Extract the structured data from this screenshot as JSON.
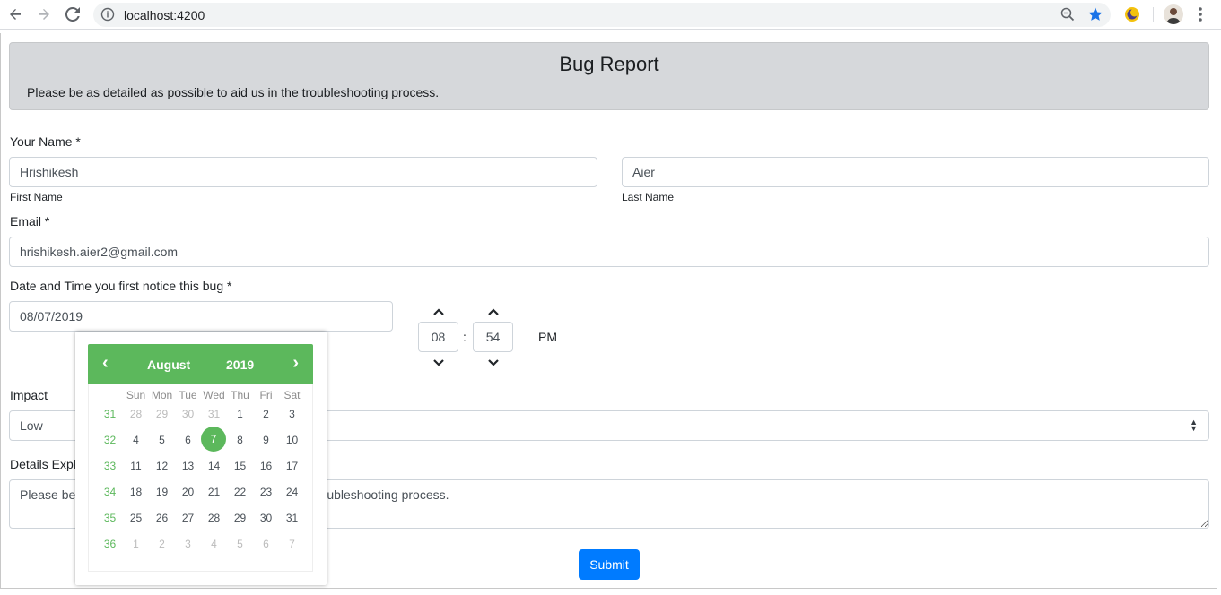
{
  "browser": {
    "url": "localhost:4200",
    "colors": {
      "star": "#1a73e8"
    }
  },
  "page": {
    "title": "Bug Report",
    "intro": "Please be as detailed as possible to aid us in the troubleshooting process."
  },
  "form": {
    "name_label": "Your Name *",
    "first_name_value": "Hrishikesh",
    "first_name_hint": "First Name",
    "last_name_value": "Aier",
    "last_name_hint": "Last Name",
    "email_label": "Email *",
    "email_value": "hrishikesh.aier2@gmail.com",
    "date_label": "Date and Time you first notice this bug *",
    "date_value": "08/07/2019",
    "hour_value": "08",
    "time_separator": ":",
    "minute_value": "54",
    "meridian": "PM",
    "impact_label": "Impact",
    "impact_value": "Low",
    "details_label": "Details Expl",
    "details_value_prefix": "Please be",
    "details_value_suffix": "ubleshooting process.",
    "submit_label": "Submit"
  },
  "datepicker": {
    "prev_label": "‹",
    "next_label": "›",
    "month": "August",
    "year": "2019",
    "accent": "#5cb85c",
    "weekdays": [
      "Sun",
      "Mon",
      "Tue",
      "Wed",
      "Thu",
      "Fri",
      "Sat"
    ],
    "weeks": [
      {
        "week": "31",
        "days": [
          "28",
          "29",
          "30",
          "31",
          "1",
          "2",
          "3"
        ]
      },
      {
        "week": "32",
        "days": [
          "4",
          "5",
          "6",
          "7",
          "8",
          "9",
          "10"
        ]
      },
      {
        "week": "33",
        "days": [
          "11",
          "12",
          "13",
          "14",
          "15",
          "16",
          "17"
        ]
      },
      {
        "week": "34",
        "days": [
          "18",
          "19",
          "20",
          "21",
          "22",
          "23",
          "24"
        ]
      },
      {
        "week": "35",
        "days": [
          "25",
          "26",
          "27",
          "28",
          "29",
          "30",
          "31"
        ]
      },
      {
        "week": "36",
        "days": [
          "1",
          "2",
          "3",
          "4",
          "5",
          "6",
          "7"
        ]
      }
    ],
    "outside_month": [
      [
        true,
        true,
        true,
        true,
        false,
        false,
        false
      ],
      [
        false,
        false,
        false,
        false,
        false,
        false,
        false
      ],
      [
        false,
        false,
        false,
        false,
        false,
        false,
        false
      ],
      [
        false,
        false,
        false,
        false,
        false,
        false,
        false
      ],
      [
        false,
        false,
        false,
        false,
        false,
        false,
        false
      ],
      [
        true,
        true,
        true,
        true,
        true,
        true,
        true
      ]
    ],
    "selected_day": "7"
  }
}
